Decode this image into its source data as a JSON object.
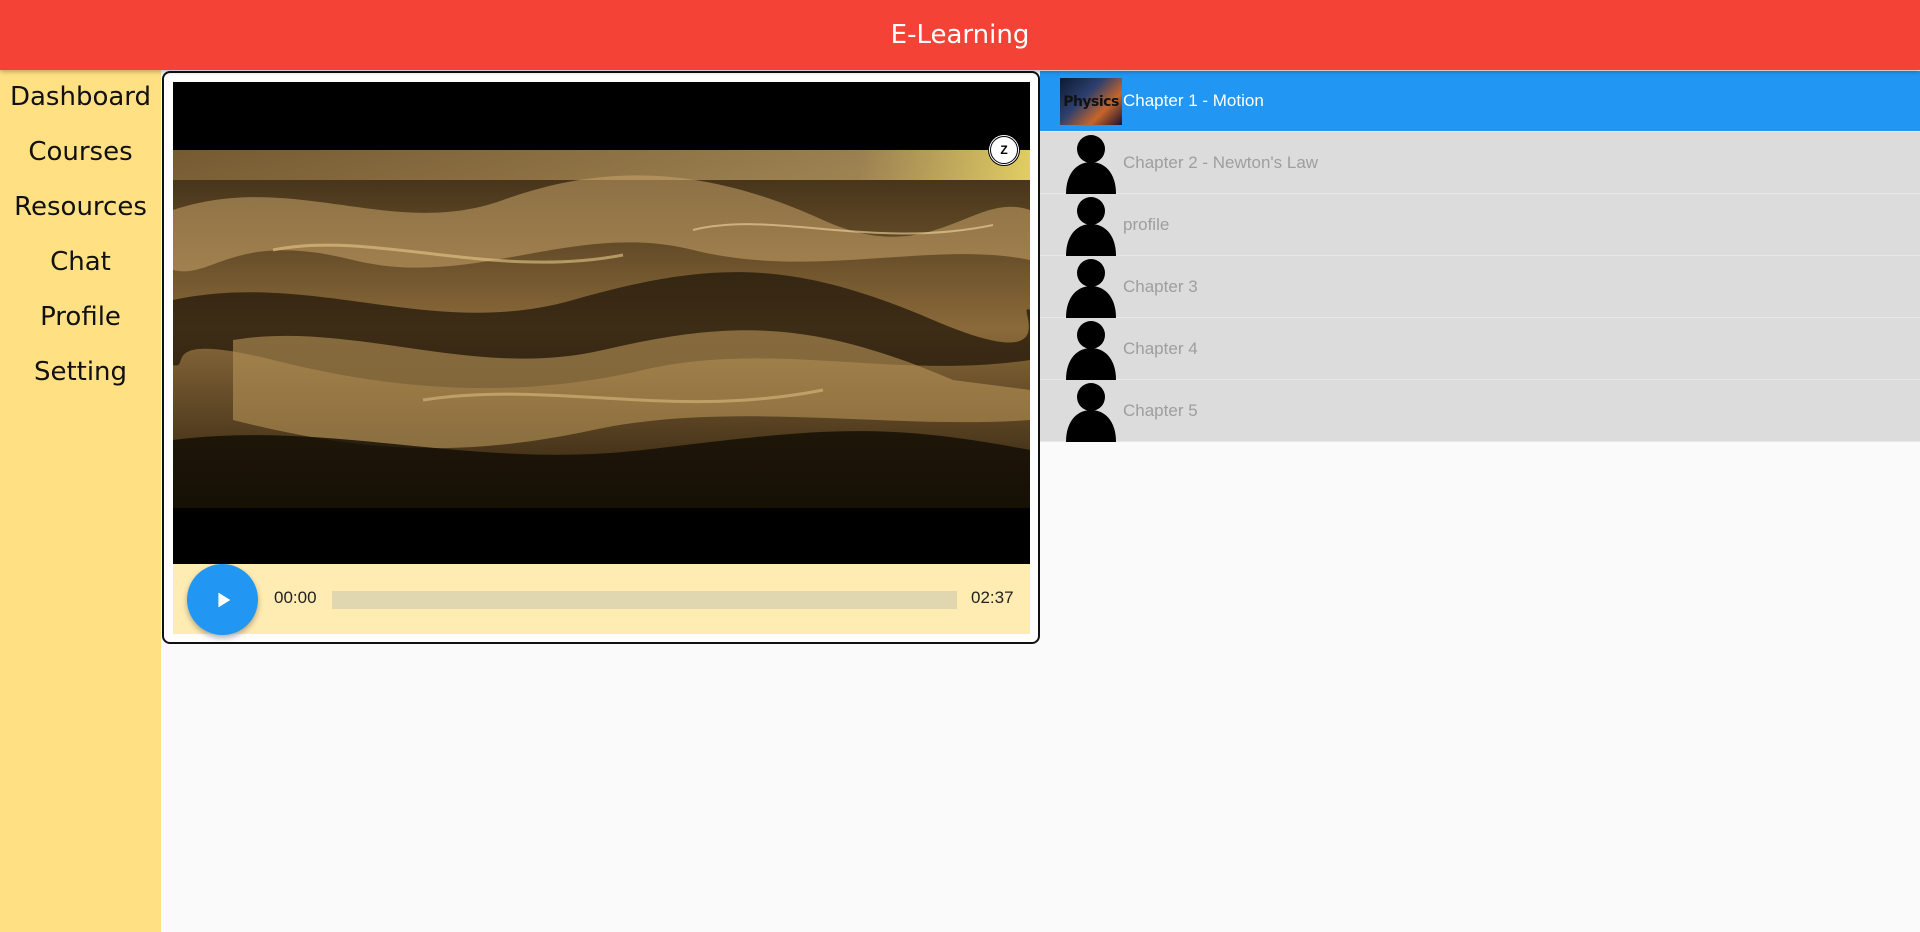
{
  "appbar": {
    "title": "E-Learning"
  },
  "sidebar": {
    "items": [
      {
        "label": "Dashboard"
      },
      {
        "label": "Courses"
      },
      {
        "label": "Resources"
      },
      {
        "label": "Chat"
      },
      {
        "label": "Profile"
      },
      {
        "label": "Setting"
      }
    ]
  },
  "player": {
    "current_time": "00:00",
    "total_time": "02:37",
    "progress": 0,
    "watermark_text": "Z",
    "play_icon": "play-icon"
  },
  "chapters": [
    {
      "title": "Chapter 1 - Motion",
      "thumb_text": "Physics",
      "active": true
    },
    {
      "title": "Chapter 2 - Newton's Law",
      "active": false
    },
    {
      "title": "profile",
      "active": false
    },
    {
      "title": "Chapter 3",
      "active": false
    },
    {
      "title": "Chapter 4",
      "active": false
    },
    {
      "title": "Chapter 5",
      "active": false
    }
  ],
  "colors": {
    "appbar": "#f44336",
    "sidebar": "#ffe082",
    "accent": "#2196f3",
    "controls_bg": "#ffecb3",
    "chapter_bg": "#dcdcdc"
  }
}
